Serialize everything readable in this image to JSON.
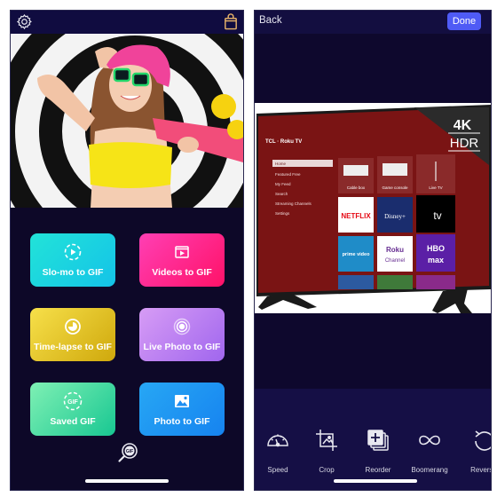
{
  "left_screen": {
    "header": {
      "settings_icon": "gear-icon",
      "store_icon": "shopping-bag-icon"
    },
    "hero_image": {
      "description": "Woman with pink beanie, green sunglasses, yellow top and pink skateboard in front of black and white concentric circles"
    },
    "buttons": [
      {
        "label": "Slo-mo to GIF",
        "icon": "slowmo-play-icon"
      },
      {
        "label": "Videos to GIF",
        "icon": "video-frame-icon"
      },
      {
        "label": "Time-lapse to GIF",
        "icon": "timelapse-icon"
      },
      {
        "label": "Live Photo to GIF",
        "icon": "live-photo-icon"
      },
      {
        "label": "Saved GIF",
        "icon": "gif-badge-icon"
      },
      {
        "label": "Photo to GIF",
        "icon": "photo-icon"
      }
    ],
    "search_gif_icon": "gif-search-icon"
  },
  "right_screen": {
    "header": {
      "back_label": "Back",
      "done_label": "Done"
    },
    "preview_image": {
      "tv_brand": "TCL · Roku TV",
      "badge_top": "4K",
      "badge_bottom": "HDR",
      "menu": [
        "Home",
        "Featured Free",
        "My Feed",
        "Search",
        "Streaming Channels",
        "Settings"
      ],
      "tiles": [
        "Cable box",
        "Game console",
        "Live TV",
        "NETFLIX",
        "Disney+",
        "tv",
        "prime video",
        "Roku Channel",
        "HBO max"
      ]
    },
    "toolbar": [
      {
        "label": "Speed",
        "icon": "speedometer-icon"
      },
      {
        "label": "Crop",
        "icon": "crop-icon"
      },
      {
        "label": "Reorder",
        "icon": "reorder-icon"
      },
      {
        "label": "Boomerang",
        "icon": "infinity-icon"
      },
      {
        "label": "Reverse",
        "icon": "reverse-icon"
      }
    ]
  }
}
